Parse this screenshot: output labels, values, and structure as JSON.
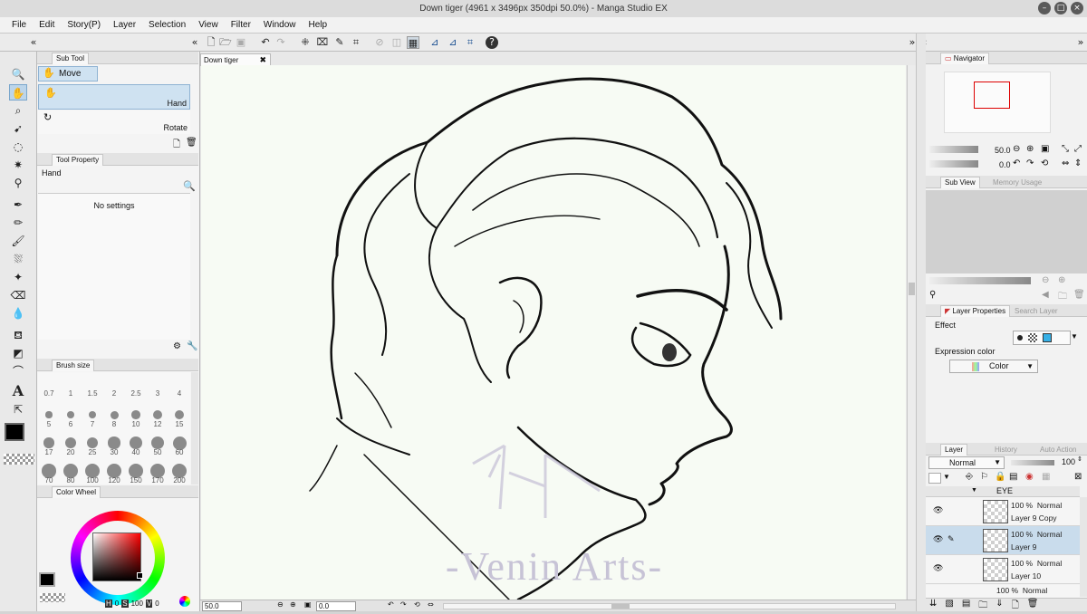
{
  "window": {
    "title": "Down tiger (4961 x 3496px 350dpi 50.0%) - Manga Studio EX"
  },
  "menu": [
    "File",
    "Edit",
    "Story(P)",
    "Layer",
    "Selection",
    "View",
    "Filter",
    "Window",
    "Help"
  ],
  "subtool": {
    "tab": "Sub Tool",
    "move_label": "Move",
    "hand_label": "Hand",
    "rotate_label": "Rotate"
  },
  "tool_property": {
    "tab": "Tool Property",
    "tool_name": "Hand",
    "empty_text": "No settings"
  },
  "brush_size": {
    "tab": "Brush size",
    "sizes": [
      "0.7",
      "1",
      "1.5",
      "2",
      "2.5",
      "3",
      "4",
      "5",
      "6",
      "7",
      "8",
      "10",
      "12",
      "15",
      "17",
      "20",
      "25",
      "30",
      "40",
      "50",
      "60",
      "70",
      "80",
      "100",
      "120",
      "150",
      "170",
      "200"
    ]
  },
  "color_wheel": {
    "tab": "Color Wheel",
    "h_label": "H",
    "h_value": "0",
    "s_label": "S",
    "s_value": "100",
    "v_label": "V",
    "v_value": "0",
    "main_color": "#000000"
  },
  "document": {
    "tab_label": "Down tiger",
    "watermark": "-Venin Arts-"
  },
  "status": {
    "zoom": "50.0",
    "angle": "0.0"
  },
  "navigator": {
    "tab": "Navigator",
    "zoom": "50.0",
    "angle": "0.0"
  },
  "subview": {
    "tab": "Sub View",
    "tab2": "Memory Usage"
  },
  "layer_properties": {
    "tab": "Layer Properties",
    "tab2": "Search Layer",
    "effect_label": "Effect",
    "expression_label": "Expression color",
    "expression_value": "Color"
  },
  "layer_panel": {
    "tab": "Layer",
    "tab2": "History",
    "tab3": "Auto Action",
    "blend_mode": "Normal",
    "opacity": "100",
    "folder_name": "EYE",
    "layers": [
      {
        "opacity": "100 %",
        "mode": "Normal",
        "name": "Layer 9 Copy",
        "selected": false
      },
      {
        "opacity": "100 %",
        "mode": "Normal",
        "name": "Layer 9",
        "selected": true
      },
      {
        "opacity": "100 %",
        "mode": "Normal",
        "name": "Layer 10",
        "selected": false
      }
    ],
    "partial_row": {
      "opacity": "100 %",
      "mode": "Normal"
    }
  }
}
